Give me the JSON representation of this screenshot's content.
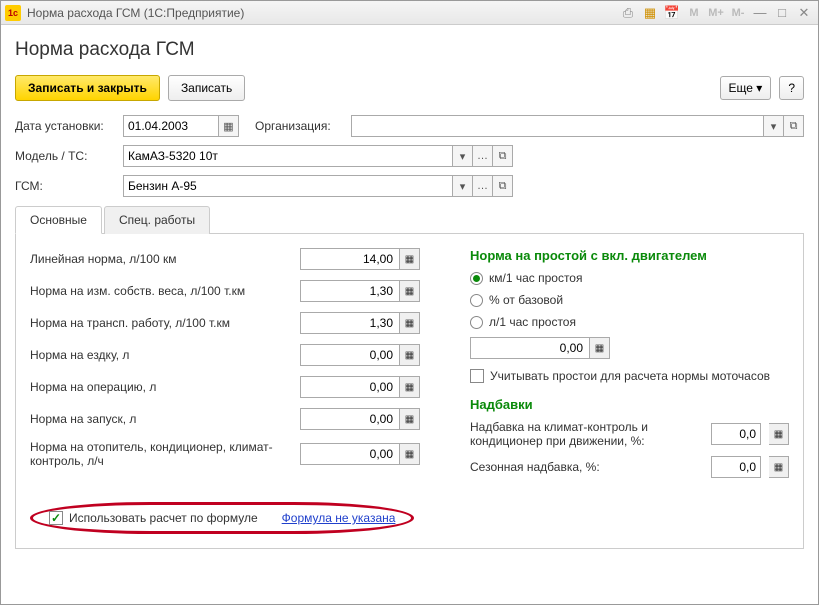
{
  "window": {
    "title": "Норма расхода ГСМ  (1С:Предприятие)"
  },
  "page": {
    "heading": "Норма расхода ГСМ"
  },
  "toolbar": {
    "save_and_close": "Записать и закрыть",
    "save": "Записать",
    "more": "Еще",
    "help": "?"
  },
  "header": {
    "date_label": "Дата установки:",
    "date_value": "01.04.2003",
    "org_label": "Организация:",
    "org_value": "",
    "model_label": "Модель / ТС:",
    "model_value": "КамАЗ-5320 10т",
    "fuel_label": "ГСМ:",
    "fuel_value": "Бензин А-95"
  },
  "tabs": {
    "main": "Основные",
    "special": "Спец. работы"
  },
  "norms": {
    "linear": {
      "label": "Линейная норма, л/100 км",
      "value": "14,00"
    },
    "own_weight": {
      "label": "Норма на изм. собств. веса, л/100 т.км",
      "value": "1,30"
    },
    "transport": {
      "label": "Норма на трансп. работу, л/100 т.км",
      "value": "1,30"
    },
    "trip": {
      "label": "Норма на ездку, л",
      "value": "0,00"
    },
    "operation": {
      "label": "Норма на операцию, л",
      "value": "0,00"
    },
    "start": {
      "label": "Норма на запуск, л",
      "value": "0,00"
    },
    "heater": {
      "label": "Норма на отопитель, кондиционер, климат-контроль, л/ч",
      "value": "0,00"
    }
  },
  "idle": {
    "title": "Норма на простой с вкл. двигателем",
    "opt_km": "км/1 час простоя",
    "opt_percent": "% от базовой",
    "opt_liter": "л/1 час простоя",
    "value": "0,00",
    "account_check": "Учитывать простои для расчета нормы моточасов"
  },
  "surcharges": {
    "title": "Надбавки",
    "climate_label": "Надбавка на климат-контроль и кондиционер при движении, %:",
    "climate_value": "0,0",
    "season_label": "Сезонная надбавка, %:",
    "season_value": "0,0"
  },
  "formula": {
    "use_label": "Использовать расчет по формуле",
    "link": "Формула не указана"
  }
}
